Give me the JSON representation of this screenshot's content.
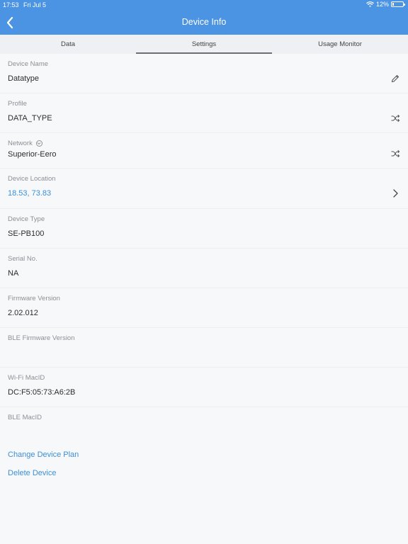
{
  "status_bar": {
    "time": "17:53",
    "date": "Fri Jul 5",
    "battery": "12%",
    "battery_level": 0.12
  },
  "header": {
    "title": "Device Info"
  },
  "tabs": [
    {
      "label": "Data",
      "active": false
    },
    {
      "label": "Settings",
      "active": true
    },
    {
      "label": "Usage Monitor",
      "active": false
    }
  ],
  "fields": {
    "device_name": {
      "label": "Device Name",
      "value": "Datatype"
    },
    "profile": {
      "label": "Profile",
      "value": "DATA_TYPE"
    },
    "network": {
      "label": "Network",
      "value": "Superior-Eero"
    },
    "device_location": {
      "label": "Device Location",
      "value": "18.53, 73.83"
    },
    "device_type": {
      "label": "Device Type",
      "value": "SE-PB100"
    },
    "serial_no": {
      "label": "Serial No.",
      "value": "NA"
    },
    "firmware_version": {
      "label": "Firmware Version",
      "value": "2.02.012"
    },
    "ble_firmware_version": {
      "label": "BLE Firmware Version",
      "value": ""
    },
    "wifi_macid": {
      "label": "Wi-Fi MacID",
      "value": "DC:F5:05:73:A6:2B"
    },
    "ble_macid": {
      "label": "BLE MacID",
      "value": ""
    }
  },
  "actions": {
    "change_plan": "Change Device Plan",
    "delete_device": "Delete Device"
  },
  "colors": {
    "header": "#4b93e3",
    "link": "#3a8fd8"
  }
}
